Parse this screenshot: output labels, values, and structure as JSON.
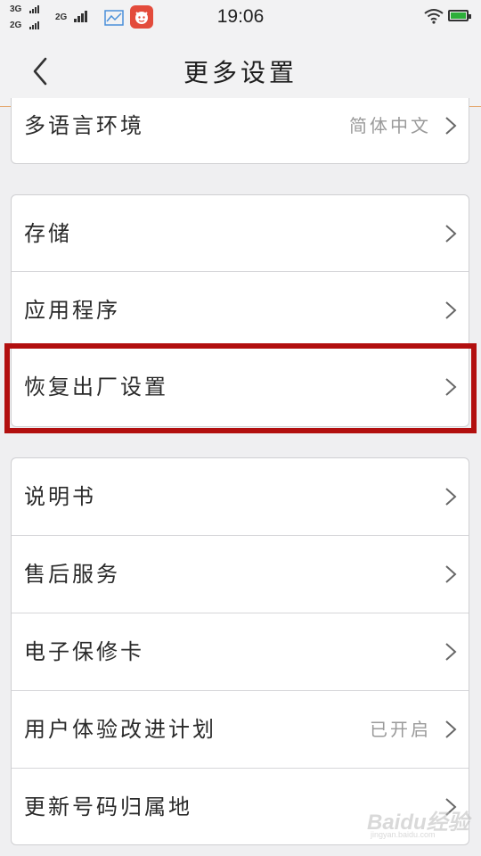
{
  "status_bar": {
    "network_top": "3G",
    "network_bottom": "2G",
    "network_mid": "2G",
    "time": "19:06",
    "battery_color": "#2dae3a"
  },
  "header": {
    "title": "更多设置",
    "back_icon": "chevron-left-icon"
  },
  "groups": [
    {
      "items": [
        {
          "label": "多语言环境",
          "value": "简体中文"
        }
      ]
    },
    {
      "items": [
        {
          "label": "存储",
          "value": ""
        },
        {
          "label": "应用程序",
          "value": ""
        },
        {
          "label": "恢复出厂设置",
          "value": ""
        }
      ]
    },
    {
      "items": [
        {
          "label": "说明书",
          "value": ""
        },
        {
          "label": "售后服务",
          "value": ""
        },
        {
          "label": "电子保修卡",
          "value": ""
        },
        {
          "label": "用户体验改进计划",
          "value": "已开启"
        },
        {
          "label": "更新号码归属地",
          "value": ""
        }
      ]
    }
  ],
  "highlight_color": "#b20f0f",
  "watermark": {
    "brand": "Baidu经验",
    "sub": "jingyan.baidu.com"
  }
}
